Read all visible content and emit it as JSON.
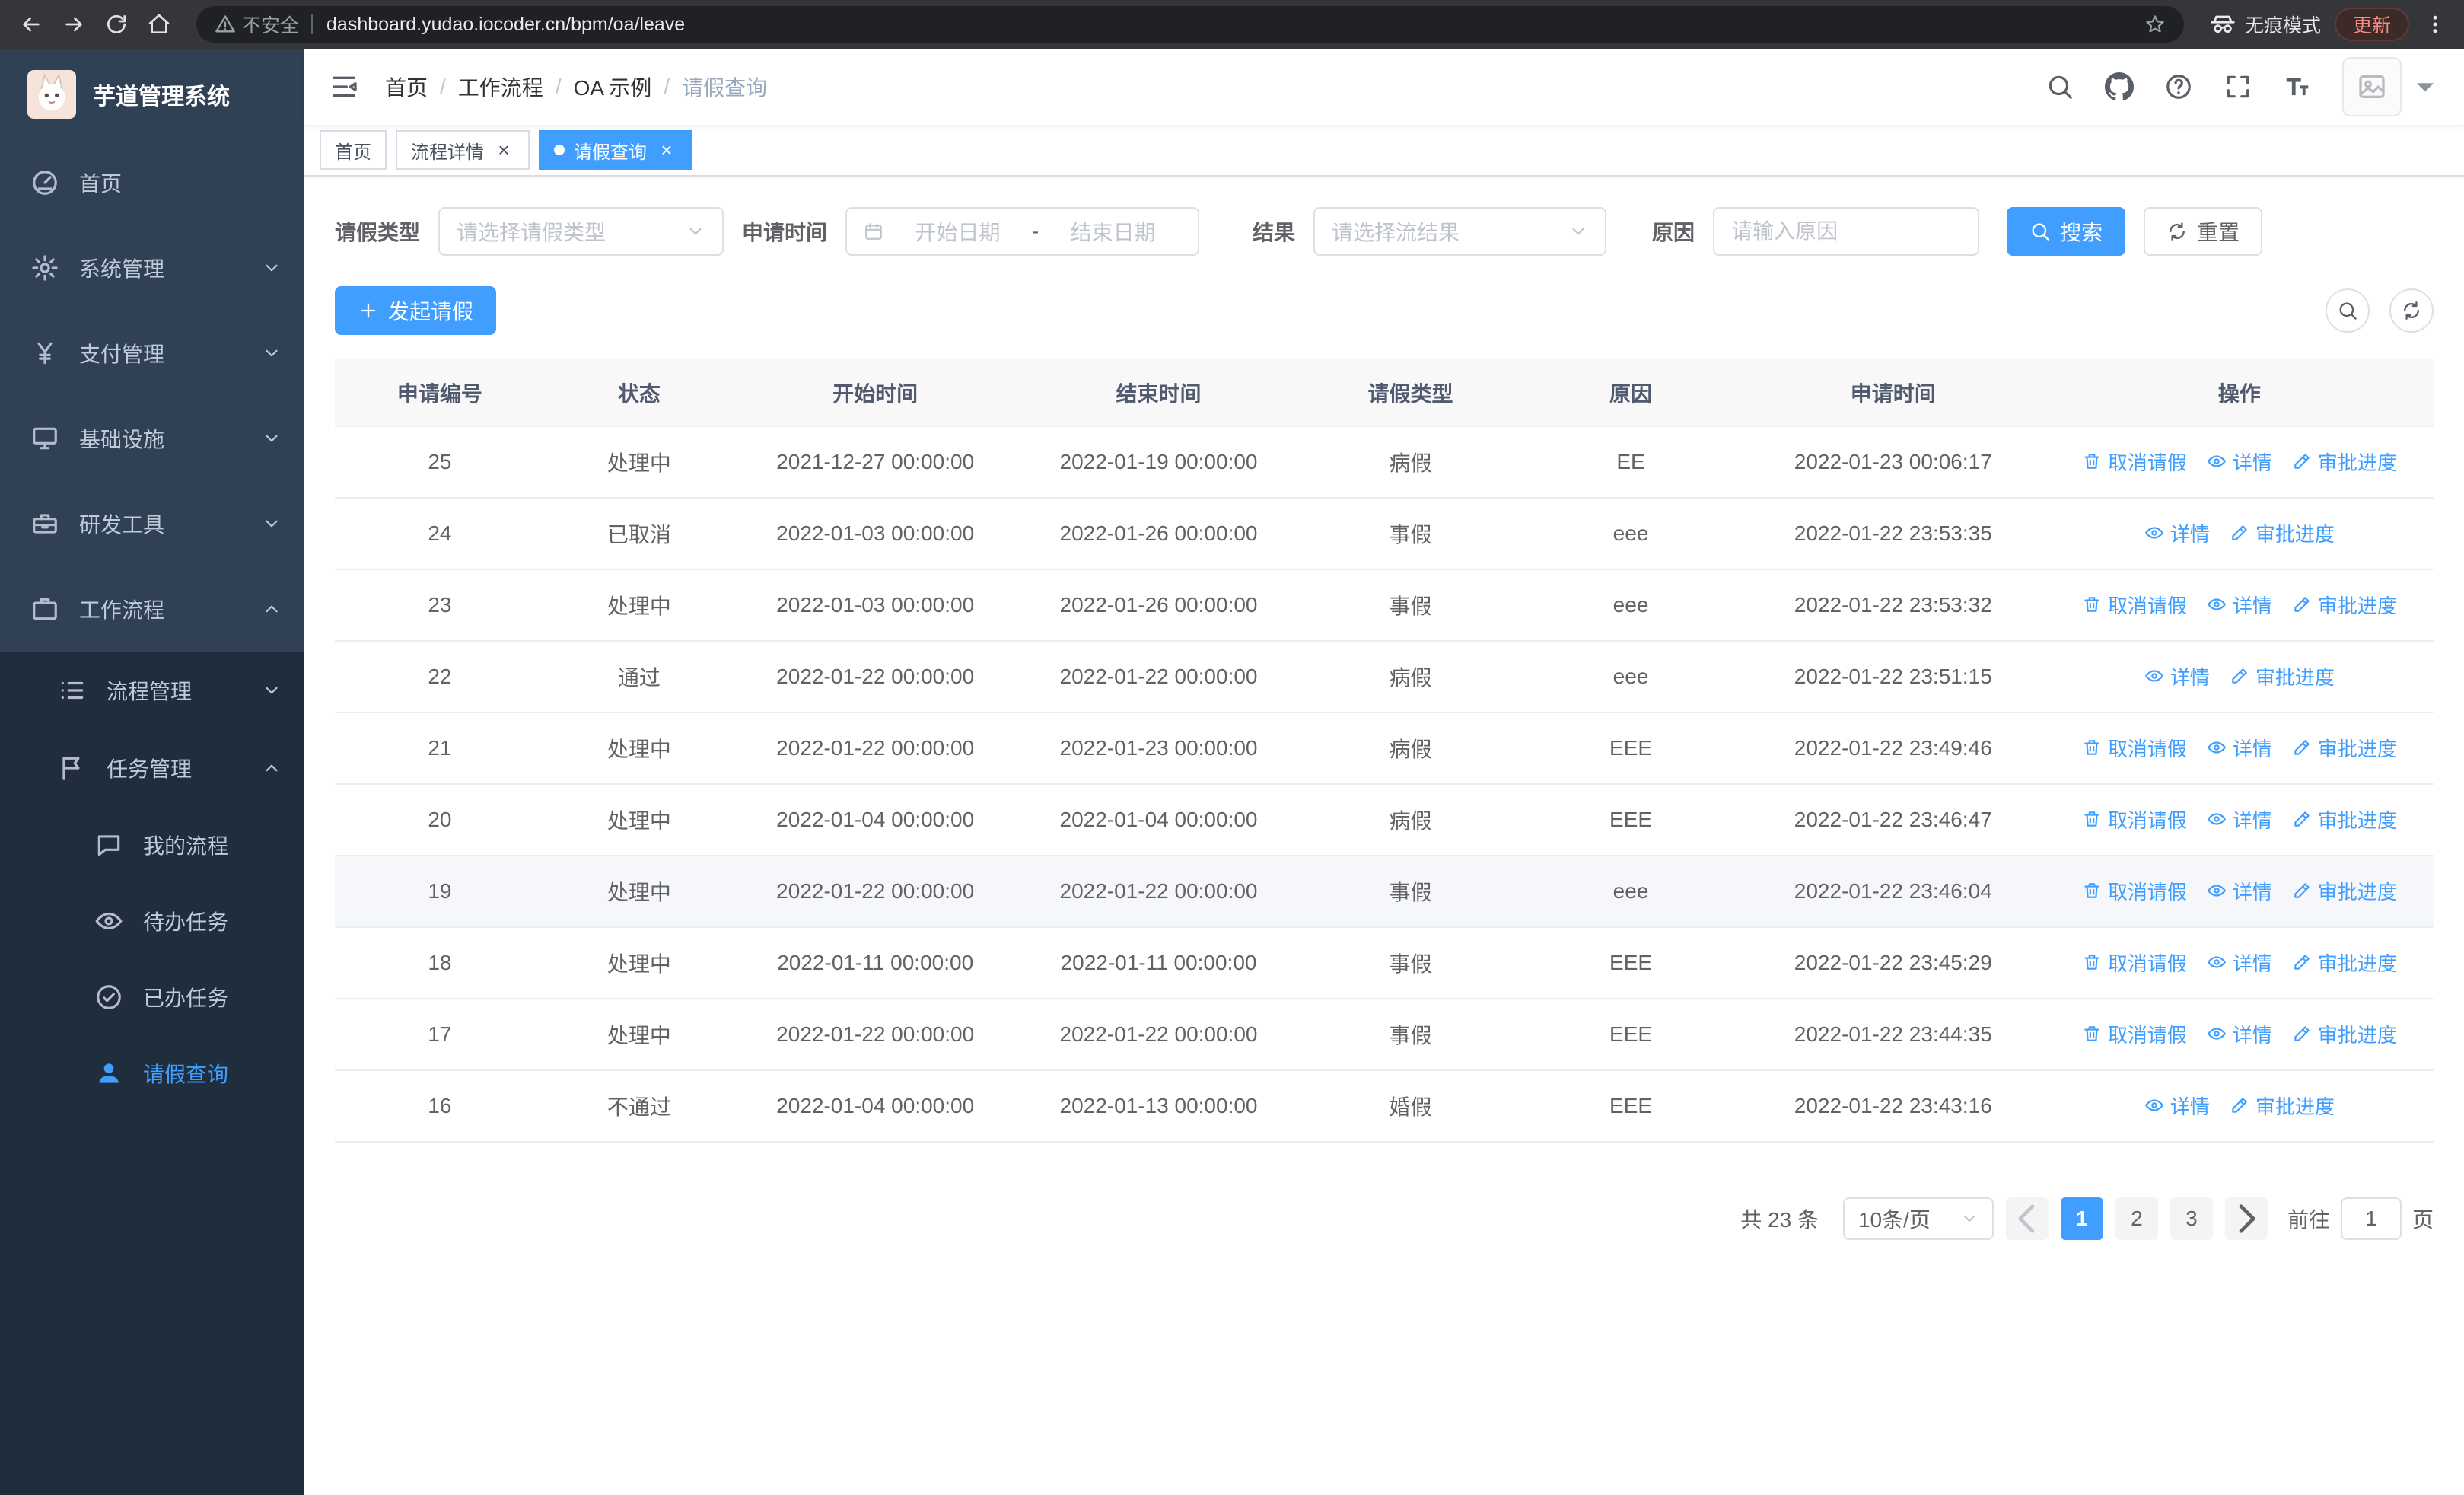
{
  "colors": {
    "primary": "#409eff",
    "sidebar_bg": "#304156",
    "submenu_bg": "#1f2d3d",
    "tab_active_bg": "#409eff"
  },
  "browser": {
    "security_label": "不安全",
    "url": "dashboard.yudao.iocoder.cn/bpm/oa/leave",
    "incognito_label": "无痕模式",
    "update_label": "更新"
  },
  "sidebar": {
    "logo_title": "芋道管理系统",
    "items": [
      {
        "key": "home",
        "label": "首页",
        "icon": "dashboard-icon",
        "level": 1
      },
      {
        "key": "system",
        "label": "系统管理",
        "icon": "gear-icon",
        "level": 1,
        "arrow": "down"
      },
      {
        "key": "payment",
        "label": "支付管理",
        "icon": "yen-icon",
        "level": 1,
        "arrow": "down"
      },
      {
        "key": "infrastructure",
        "label": "基础设施",
        "icon": "monitor-icon",
        "level": 1,
        "arrow": "down"
      },
      {
        "key": "devtools",
        "label": "研发工具",
        "icon": "toolbox-icon",
        "level": 1,
        "arrow": "down"
      },
      {
        "key": "workflow",
        "label": "工作流程",
        "icon": "briefcase-icon",
        "level": 1,
        "arrow": "up",
        "expanded": true
      },
      {
        "key": "process-mgmt",
        "label": "流程管理",
        "icon": "list-icon",
        "level": 2,
        "arrow": "down"
      },
      {
        "key": "task-mgmt",
        "label": "任务管理",
        "icon": "flag-icon",
        "level": 2,
        "arrow": "up",
        "expanded": true
      },
      {
        "key": "my-process",
        "label": "我的流程",
        "icon": "chat-icon",
        "level": 3
      },
      {
        "key": "todo-task",
        "label": "待办任务",
        "icon": "eye-icon",
        "level": 3
      },
      {
        "key": "done-task",
        "label": "已办任务",
        "icon": "done-icon",
        "level": 3
      },
      {
        "key": "leave-query",
        "label": "请假查询",
        "icon": "user-icon",
        "level": 3,
        "active": true
      }
    ]
  },
  "header": {
    "breadcrumb": [
      "首页",
      "工作流程",
      "OA 示例",
      "请假查询"
    ]
  },
  "tabs": [
    {
      "key": "home",
      "label": "首页",
      "closable": false,
      "active": false
    },
    {
      "key": "process-detail",
      "label": "流程详情",
      "closable": true,
      "active": false
    },
    {
      "key": "leave-query",
      "label": "请假查询",
      "closable": true,
      "active": true
    }
  ],
  "filters": {
    "leave_type_label": "请假类型",
    "leave_type_placeholder": "请选择请假类型",
    "apply_time_label": "申请时间",
    "start_date_placeholder": "开始日期",
    "range_separator": "-",
    "end_date_placeholder": "结束日期",
    "result_label": "结果",
    "result_placeholder": "请选择流结果",
    "reason_label": "原因",
    "reason_placeholder": "请输入原因",
    "search_label": "搜索",
    "reset_label": "重置"
  },
  "toolbar": {
    "create_label": "发起请假"
  },
  "table": {
    "columns": [
      "申请编号",
      "状态",
      "开始时间",
      "结束时间",
      "请假类型",
      "原因",
      "申请时间",
      "操作"
    ],
    "action_labels": {
      "cancel": "取消请假",
      "detail": "详情",
      "progress": "审批进度"
    },
    "rows": [
      {
        "id": "25",
        "status": "处理中",
        "start": "2021-12-27 00:00:00",
        "end": "2022-01-19 00:00:00",
        "type": "病假",
        "reason": "EE",
        "applied": "2022-01-23 00:06:17",
        "actions": [
          "cancel",
          "detail",
          "progress"
        ]
      },
      {
        "id": "24",
        "status": "已取消",
        "start": "2022-01-03 00:00:00",
        "end": "2022-01-26 00:00:00",
        "type": "事假",
        "reason": "eee",
        "applied": "2022-01-22 23:53:35",
        "actions": [
          "detail",
          "progress"
        ]
      },
      {
        "id": "23",
        "status": "处理中",
        "start": "2022-01-03 00:00:00",
        "end": "2022-01-26 00:00:00",
        "type": "事假",
        "reason": "eee",
        "applied": "2022-01-22 23:53:32",
        "actions": [
          "cancel",
          "detail",
          "progress"
        ]
      },
      {
        "id": "22",
        "status": "通过",
        "start": "2022-01-22 00:00:00",
        "end": "2022-01-22 00:00:00",
        "type": "病假",
        "reason": "eee",
        "applied": "2022-01-22 23:51:15",
        "actions": [
          "detail",
          "progress"
        ]
      },
      {
        "id": "21",
        "status": "处理中",
        "start": "2022-01-22 00:00:00",
        "end": "2022-01-23 00:00:00",
        "type": "病假",
        "reason": "EEE",
        "applied": "2022-01-22 23:49:46",
        "actions": [
          "cancel",
          "detail",
          "progress"
        ]
      },
      {
        "id": "20",
        "status": "处理中",
        "start": "2022-01-04 00:00:00",
        "end": "2022-01-04 00:00:00",
        "type": "病假",
        "reason": "EEE",
        "applied": "2022-01-22 23:46:47",
        "actions": [
          "cancel",
          "detail",
          "progress"
        ]
      },
      {
        "id": "19",
        "status": "处理中",
        "start": "2022-01-22 00:00:00",
        "end": "2022-01-22 00:00:00",
        "type": "事假",
        "reason": "eee",
        "applied": "2022-01-22 23:46:04",
        "actions": [
          "cancel",
          "detail",
          "progress"
        ],
        "highlighted": true
      },
      {
        "id": "18",
        "status": "处理中",
        "start": "2022-01-11 00:00:00",
        "end": "2022-01-11 00:00:00",
        "type": "事假",
        "reason": "EEE",
        "applied": "2022-01-22 23:45:29",
        "actions": [
          "cancel",
          "detail",
          "progress"
        ]
      },
      {
        "id": "17",
        "status": "处理中",
        "start": "2022-01-22 00:00:00",
        "end": "2022-01-22 00:00:00",
        "type": "事假",
        "reason": "EEE",
        "applied": "2022-01-22 23:44:35",
        "actions": [
          "cancel",
          "detail",
          "progress"
        ]
      },
      {
        "id": "16",
        "status": "不通过",
        "start": "2022-01-04 00:00:00",
        "end": "2022-01-13 00:00:00",
        "type": "婚假",
        "reason": "EEE",
        "applied": "2022-01-22 23:43:16",
        "actions": [
          "detail",
          "progress"
        ]
      }
    ]
  },
  "pagination": {
    "total_label": "共 23 条",
    "page_size_label": "10条/页",
    "pages": [
      "1",
      "2",
      "3"
    ],
    "active_page": "1",
    "goto_label": "前往",
    "goto_value": "1",
    "page_unit_label": "页"
  }
}
